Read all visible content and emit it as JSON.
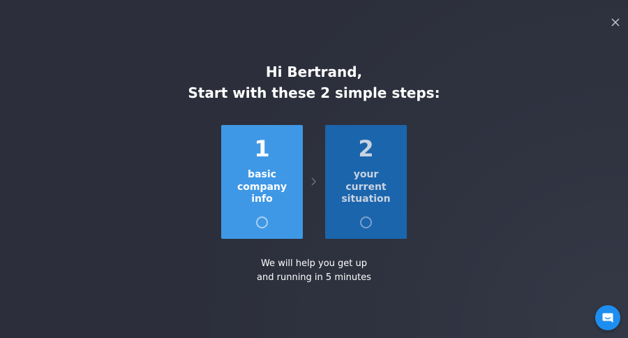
{
  "header": {
    "greeting": "Hi Bertrand,",
    "subtitle": "Start with these 2 simple steps:"
  },
  "steps": [
    {
      "number": "1",
      "label_lines": [
        "basic",
        "company",
        "info"
      ]
    },
    {
      "number": "2",
      "label_lines": [
        "your",
        "current",
        "situation"
      ]
    }
  ],
  "footer": {
    "line1": "We will help you get up",
    "line2": "and running in 5 minutes"
  },
  "icons": {
    "close": "close-icon",
    "chevron": "chevron-right-icon",
    "step_status": "circle-outline-icon",
    "chat": "chat-bubble-icon"
  },
  "colors": {
    "background": "#2c2f3b",
    "step1": "#3f98e6",
    "step2": "#1b65ad",
    "chat_button": "#1d8ef0"
  }
}
